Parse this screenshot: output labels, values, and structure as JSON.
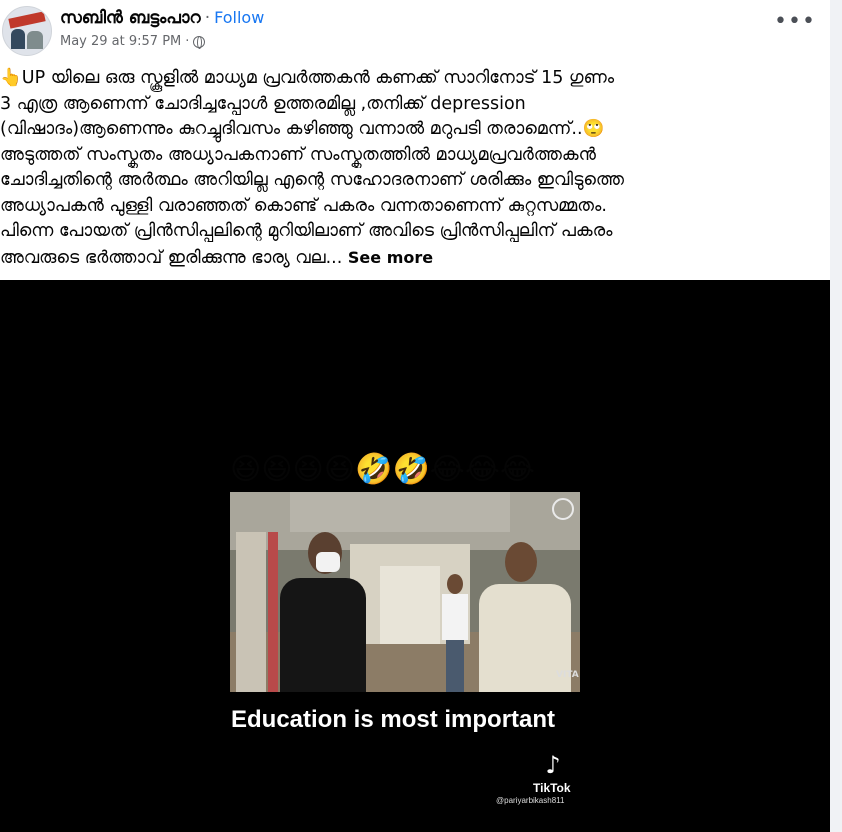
{
  "post": {
    "author": "സബിൻ ബട്ടംപാറ",
    "separator": "·",
    "follow_label": "Follow",
    "timestamp": "May 29 at 9:57 PM",
    "timestamp_sep": "·",
    "privacy_icon": "globe-icon",
    "more_label": "•••",
    "lines": [
      "👆UP യിലെ ഒരു സ്കൂളിൽ മാധ്യമ പ്രവർത്തകൻ കണക്ക് സാറിനോട് 15 ഗുണം",
      "3 എത്ര ആണെന്ന് ചോദിച്ചപ്പോൾ ഉത്തരമില്ല ,തനിക്ക് depression",
      "(വിഷാദം)ആണെന്നും കുറച്ചുദിവസം കഴിഞ്ഞു വന്നാൽ മറുപടി തരാമെന്ന്..🙄",
      "അടുത്തത് സംസ്കൃതം അധ്യാപകനാണ് സംസ്കൃതത്തിൽ മാധ്യമപ്രവർത്തകൻ",
      "ചോദിച്ചതിന്റെ അർത്ഥം അറിയില്ല എന്റെ സഹോദരനാണ് ശരിക്കും ഇവിടുത്തെ",
      "അധ്യാപകൻ പുള്ളി വരാഞ്ഞത് കൊണ്ട് പകരം വന്നതാണെന്ന് കുറ്റസമ്മതം.",
      "പിന്നെ പോയത് പ്രിൻസിപ്പലിന്റെ മുറിയിലാണ് അവിടെ പ്രിൻസിപ്പലിന് പകരം"
    ],
    "last_line": "അവരുടെ ഭർത്താവ് ഇരിക്കുന്നു ഭാര്യ വല...",
    "see_more_label": "See more"
  },
  "video": {
    "emoji_row": "😆😆😆😆🤣🤣😂😂😂",
    "caption": "Education is most important",
    "watermark_brand": "TikTok",
    "watermark_handle": "@pariyarbikash811",
    "vita_label": "VITA",
    "tiktok_icon": "tiktok-note-icon"
  }
}
